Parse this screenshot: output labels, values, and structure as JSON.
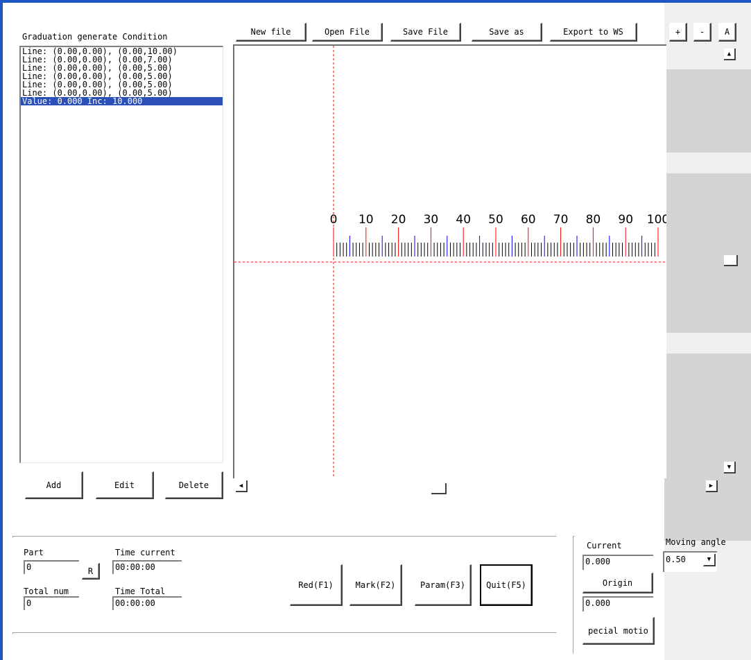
{
  "left_panel": {
    "title": "Graduation generate Condition",
    "items": [
      "Line:  (0.00,0.00), (0.00,10.00)",
      "Line:  (0.00,0.00), (0.00,7.00)",
      "Line:  (0.00,0.00), (0.00,5.00)",
      "Line:  (0.00,0.00), (0.00,5.00)",
      "Line:  (0.00,0.00), (0.00,5.00)",
      "Line:  (0.00,0.00), (0.00,5.00)",
      "Value: 0.000 Inc: 10.000"
    ],
    "selected_index": 6,
    "add_label": "Add",
    "edit_label": "Edit",
    "delete_label": "Delete"
  },
  "toolbar": {
    "new_file": "New file",
    "open_file": "Open File",
    "save_file": "Save File",
    "save_as": "Save as",
    "export_ws": "Export to WS",
    "zoom_in": "+",
    "zoom_out": "-",
    "auto": "A"
  },
  "ruler": {
    "labels": [
      "0",
      "10",
      "20",
      "30",
      "40",
      "50",
      "60",
      "70",
      "80",
      "90",
      "100"
    ],
    "major_color": "#ff0000",
    "mid_color": "#0000ff",
    "minor_color": "#000000",
    "axis_color": "#ff0000"
  },
  "status": {
    "part_label": "Part",
    "part_value": "0",
    "r_label": "R",
    "total_num_label": "Total num",
    "total_num_value": "0",
    "time_current_label": "Time current",
    "time_current_value": "00:00:00",
    "time_total_label": "Time Total",
    "time_total_value": "00:00:00"
  },
  "actions": {
    "red": "Red(F1)",
    "mark": "Mark(F2)",
    "param": "Param(F3)",
    "quit": "Quit(F5)"
  },
  "motion": {
    "current_label": "Current",
    "current_value": "0.000",
    "origin_label": "Origin",
    "origin_value": "0.000",
    "special_motion_label": "pecial motio",
    "moving_angle_label": "Moving angle",
    "moving_angle_value": "0.50"
  }
}
